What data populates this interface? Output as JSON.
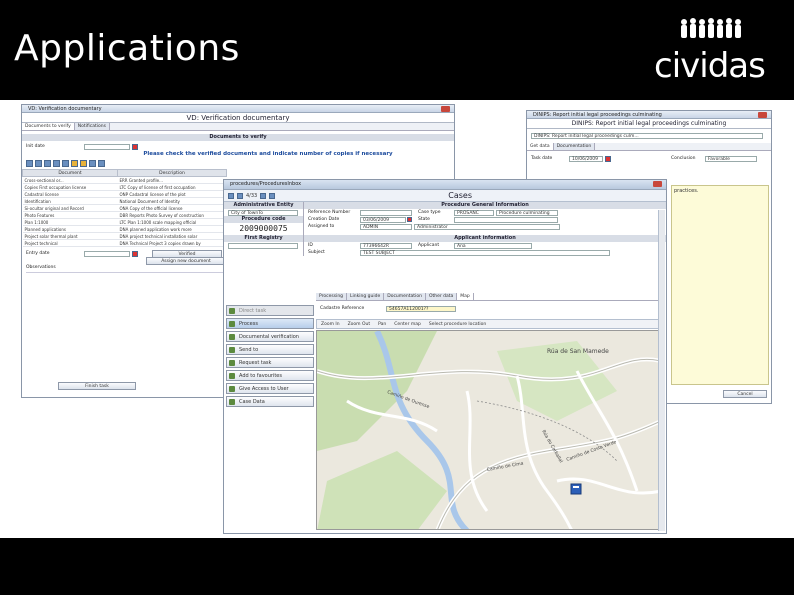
{
  "slide": {
    "title": "Applications",
    "logo_text": "cividas"
  },
  "win_left": {
    "title": "VD: Verification documentary",
    "header": "VD: Verification documentary",
    "tabs": [
      "Documents to verify",
      "Notifications"
    ],
    "section": "Documents to verify",
    "date_label": "Init date",
    "note": "Please check the verified documents and indicate number of copies if necessary",
    "columns": [
      "Document",
      "Description"
    ],
    "rows": [
      [
        "Cross-sectional or...",
        "ERR Granted profile..."
      ],
      [
        "Copies First occupation license",
        "LTC Copy of license of first occupation"
      ],
      [
        "Cadastral license",
        "ONP Cadastral license of the plot"
      ],
      [
        "Identification",
        "National Document of Identity"
      ],
      [
        "Si-ocultar original and Record",
        "ONA Copy of the official license"
      ],
      [
        "Photo Features",
        "DBR Reports Photo Survey of construction"
      ],
      [
        "Plan 1:1000",
        "LTC Plan 1:1000 scale mapping official"
      ],
      [
        "Planned applications",
        "DNA planned application work more"
      ],
      [
        "Project solar thermal plant",
        "DNA project technical installation solar"
      ],
      [
        "Project technical",
        "DNA Technical Project 3 copies drawn by"
      ]
    ],
    "entry_label": "Entry date",
    "verified_btn": "Verified",
    "assign_btn": "Assign new document",
    "observations": "Observations",
    "finish_btn": "Finish task"
  },
  "win_right": {
    "title": "DINIPS: Report initial legal proceedings culminating",
    "header": "DINIPS: Report initial legal proceedings culminating",
    "field_value": "DINIPS: Report initial legal proceedings culm...",
    "tabs": [
      "Get data",
      "Documentation"
    ],
    "task_date_label": "Task date",
    "task_date": "10/06/2009",
    "conclusion_label": "Conclusion",
    "conclusion": "Favorable",
    "memo": "practices.",
    "cancel_btn": "Cancel"
  },
  "cases": {
    "title": "procedures/ProceduresInbox",
    "window_title": "Cases",
    "pager": "4/33",
    "admin_entity_hdr": "Administrative Entity",
    "admin_entity": "City of TownTo",
    "proc_general_hdr": "Procedure General Information",
    "ref_label": "Reference Number",
    "case_type_label": "Case type",
    "case_type_code": "PROSANC",
    "case_type_desc": "Procedure culminating",
    "proc_code_hdr": "Procedure code",
    "proc_code": "2009000075",
    "creation_label": "Creation Date",
    "creation_date": "03/06/2009",
    "state_label": "State",
    "assigned_label": "Assigned to",
    "assigned_code": "ADMIN",
    "assigned_name": "Administrator",
    "first_registry_hdr": "First Registry",
    "applicant_hdr": "Applicant information",
    "id_label": "ID",
    "id_value": "77396642R",
    "applicant_label": "Applicant",
    "applicant_value": "Ana",
    "subject_label": "Subject",
    "subject_value": "TEST SUBJECT",
    "left_buttons": [
      "Direct task",
      "Process",
      "Documental verification",
      "Send to",
      "Request task",
      "Add to favourites",
      "Give Access to User",
      "Case Data"
    ],
    "sub_tabs": [
      "Processing",
      "Linking guide",
      "Documentation",
      "Other data",
      "Map"
    ],
    "cadastre_label": "Cadastre Reference",
    "cadastre_value": "54657A112001??",
    "map_tools": [
      "Zoom In",
      "Zoom Out",
      "Pan",
      "Center map",
      "Select procedure location"
    ],
    "street_labels": [
      "Rúa de San Mamede",
      "Camiño de Ourense",
      "Camiño de Cima",
      "Rúa do Carballal",
      "Camiño de Costa Verde"
    ]
  },
  "colors": {
    "band": "#ffffff",
    "bg": "#000000",
    "note": "#1b4a9c"
  }
}
